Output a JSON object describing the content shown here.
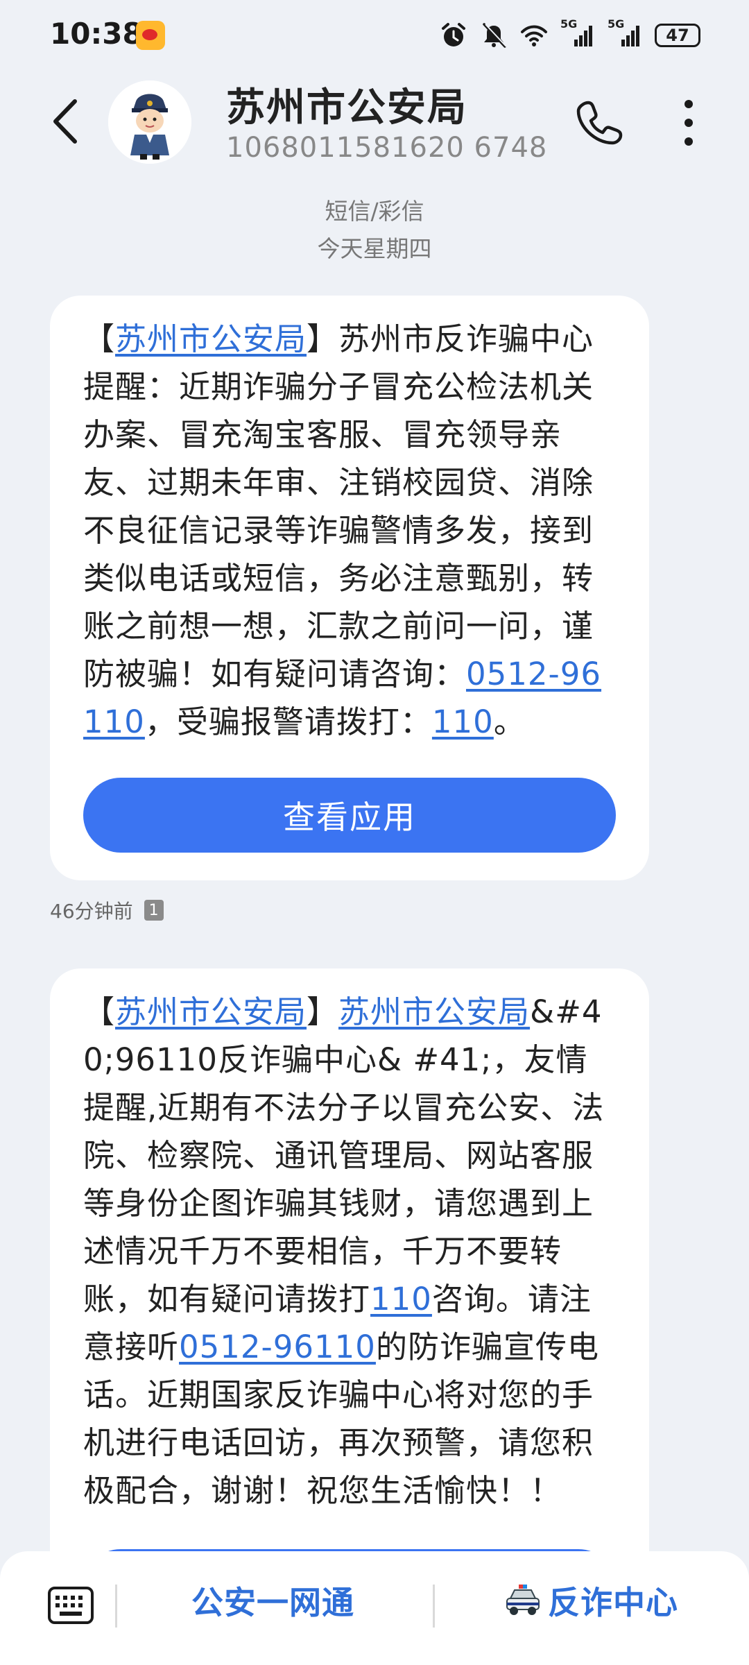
{
  "status": {
    "time": "10:38",
    "battery": "47",
    "signal1": "5G",
    "signal2": "5G"
  },
  "header": {
    "name": "苏州市公安局",
    "number": "1068011581620 6748"
  },
  "thread": {
    "channel": "短信/彩信",
    "date": "今天星期四"
  },
  "message1": {
    "bracket_open": "【",
    "sender_link": "苏州市公安局",
    "bracket_close": "】",
    "body": "苏州市反诈骗中心提醒：近期诈骗分子冒充公检法机关办案、冒充淘宝客服、冒充领导亲友、过期未年审、注销校园贷、消除不良征信记录等诈骗警情多发，接到类似电话或短信，务必注意甄别，转账之前想一想，汇款之前问一问，谨防被骗！如有疑问请咨询：",
    "phone_link": "0512-96110",
    "mid": "，受骗报警请拨打：",
    "emergency_link": "110",
    "end": "。",
    "button": "查看应用",
    "time": "46分钟前",
    "sim": "1"
  },
  "message2": {
    "bracket_open": "【",
    "sender_link": "苏州市公安局",
    "bracket_close": "】",
    "sender_link2": "苏州市公安局",
    "body": "&#40;96110反诈骗中心& #41;，友情提醒,近期有不法分子以冒充公安、法院、检察院、通讯管理局、网站客服等身份企图诈骗其钱财，请您遇到上述情况千万不要相信，千万不要转账，如有疑问请拨打",
    "emergency_link": "110",
    "mid": "咨询。请注意接听",
    "phone_link": "0512-96110",
    "end": "的防诈骗宣传电话。近期国家反诈骗中心将对您的手机进行电话回访，再次预警，请您积极配合，谢谢！祝您生活愉快！！"
  },
  "bottom": {
    "menu1": "公安一网通",
    "menu2": "反诈中心"
  }
}
